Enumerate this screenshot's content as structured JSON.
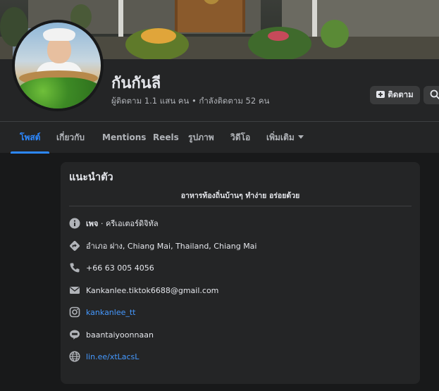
{
  "profile": {
    "name": "กันกันลี",
    "stats": "ผู้ติดตาม 1.1 แสน คน • กำลังติดตาม 52 คน"
  },
  "actions": {
    "follow_label": "ติดตาม"
  },
  "tabs": [
    {
      "label": "โพสต์",
      "active": true
    },
    {
      "label": "เกี่ยวกับ",
      "active": false
    },
    {
      "label": "Mentions",
      "active": false
    },
    {
      "label": "Reels",
      "active": false
    },
    {
      "label": "รูปภาพ",
      "active": false
    },
    {
      "label": "วิดีโอ",
      "active": false
    },
    {
      "label": "เพิ่มเติม",
      "active": false
    }
  ],
  "intro": {
    "title": "แนะนำตัว",
    "bio": "อาหารท้องถิ่นบ้านๆ ทำง่าย อร่อยด้วย",
    "category_bold": "เพจ",
    "category_rest": " · ครีเอเตอร์ดิจิทัล",
    "location": "อำเภอ ฝาง, Chiang Mai, Thailand, Chiang Mai",
    "phone": "+66 63 005 4056",
    "email": "Kankanlee.tiktok6688@gmail.com",
    "instagram": "kankanlee_tt",
    "line": "baantaiyoonnaan",
    "website": "lin.ee/xtLacsL"
  },
  "icons": {
    "info": "info-icon",
    "location": "directions-icon",
    "phone": "phone-icon",
    "email": "mail-icon",
    "instagram": "instagram-icon",
    "line": "line-icon",
    "website": "globe-icon",
    "follow": "follow-icon",
    "search": "search-icon"
  },
  "colors": {
    "background": "#18191a",
    "surface": "#242526",
    "accent": "#2d88ff",
    "link": "#4599ff",
    "text_primary": "#e4e6eb",
    "text_secondary": "#b0b3b8"
  }
}
